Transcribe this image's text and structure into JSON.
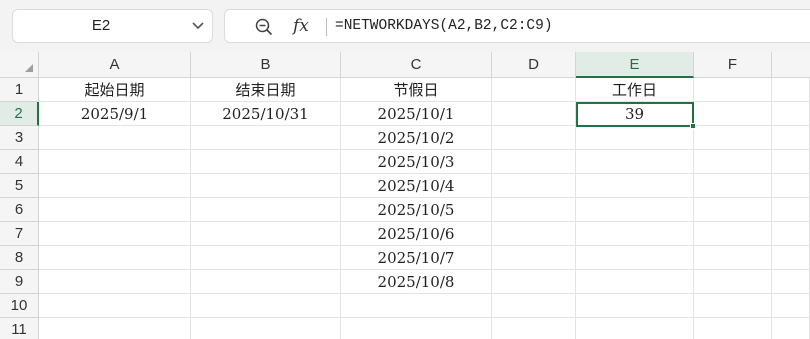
{
  "formula_bar": {
    "name_box": "E2",
    "zoom_icon": "zoom-in-icon",
    "fx_label": "fx",
    "formula": "=NETWORKDAYS(A2,B2,C2:C9)"
  },
  "sheet": {
    "columns": [
      "A",
      "B",
      "C",
      "D",
      "E",
      "F"
    ],
    "rows": [
      "1",
      "2",
      "3",
      "4",
      "5",
      "6",
      "7",
      "8",
      "9",
      "10",
      "11"
    ],
    "selected_cell": "E2",
    "cells": {
      "A1": "起始日期",
      "B1": "结束日期",
      "C1": "节假日",
      "E1": "工作日",
      "A2": "2025/9/1",
      "B2": "2025/10/31",
      "C2": "2025/10/1",
      "E2": "39",
      "C3": "2025/10/2",
      "C4": "2025/10/3",
      "C5": "2025/10/4",
      "C6": "2025/10/5",
      "C7": "2025/10/6",
      "C8": "2025/10/7",
      "C9": "2025/10/8"
    }
  },
  "colors": {
    "accent": "#217346",
    "header_bg": "#f5f5f5",
    "toolbar_bg": "#f3f3f3"
  }
}
